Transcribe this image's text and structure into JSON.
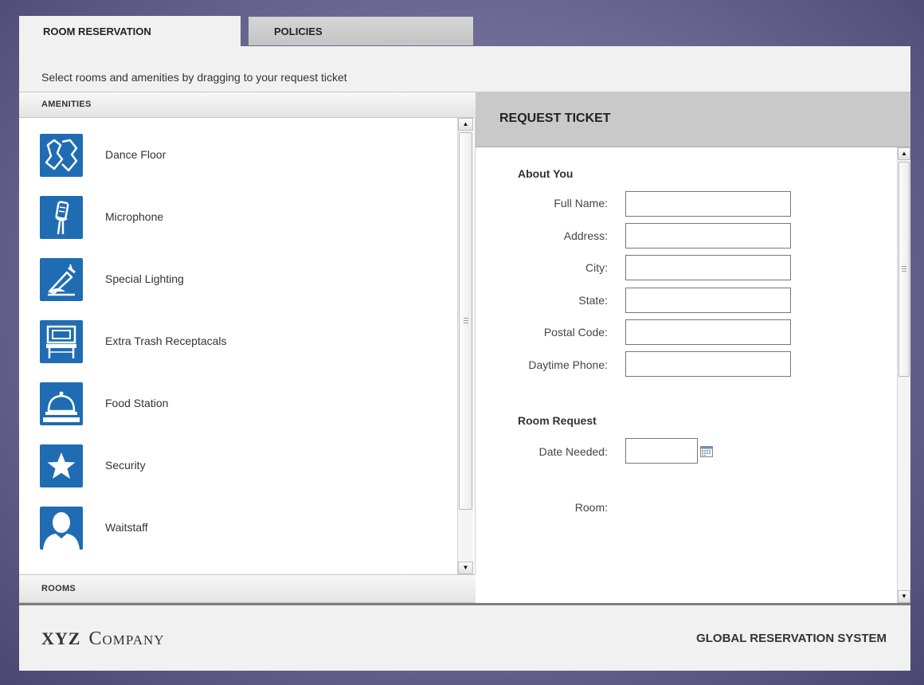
{
  "tabs": [
    {
      "label": "ROOM RESERVATION",
      "active": true
    },
    {
      "label": "POLICIES",
      "active": false
    }
  ],
  "instructions": "Select rooms and amenities by dragging to your request ticket",
  "amenities_header": "AMENITIES",
  "rooms_header": "ROOMS",
  "amenities": [
    {
      "label": "Dance Floor",
      "icon": "dance-floor-icon"
    },
    {
      "label": "Microphone",
      "icon": "microphone-icon"
    },
    {
      "label": "Special Lighting",
      "icon": "lighting-icon"
    },
    {
      "label": "Extra Trash Receptacals",
      "icon": "trash-receptacle-icon"
    },
    {
      "label": "Food Station",
      "icon": "food-station-icon"
    },
    {
      "label": "Security",
      "icon": "star-icon"
    },
    {
      "label": "Waitstaff",
      "icon": "person-icon"
    }
  ],
  "ticket": {
    "title": "REQUEST TICKET",
    "about_title": "About You",
    "fields": {
      "full_name": {
        "label": "Full Name:",
        "value": ""
      },
      "address": {
        "label": "Address:",
        "value": ""
      },
      "city": {
        "label": "City:",
        "value": ""
      },
      "state": {
        "label": "State:",
        "value": ""
      },
      "postal_code": {
        "label": "Postal Code:",
        "value": ""
      },
      "daytime_phone": {
        "label": "Daytime Phone:",
        "value": ""
      }
    },
    "room_request_title": "Room Request",
    "date_needed": {
      "label": "Date Needed:",
      "value": ""
    },
    "room_label": "Room:"
  },
  "footer": {
    "logo_bold": "XYZ",
    "logo_rest": "Company",
    "system_name": "GLOBAL RESERVATION SYSTEM"
  },
  "colors": {
    "accent_icon": "#1f6cb3",
    "background": "#6c6a92",
    "panel": "#f1f1f1",
    "ticket_header": "#c9c9c9"
  }
}
